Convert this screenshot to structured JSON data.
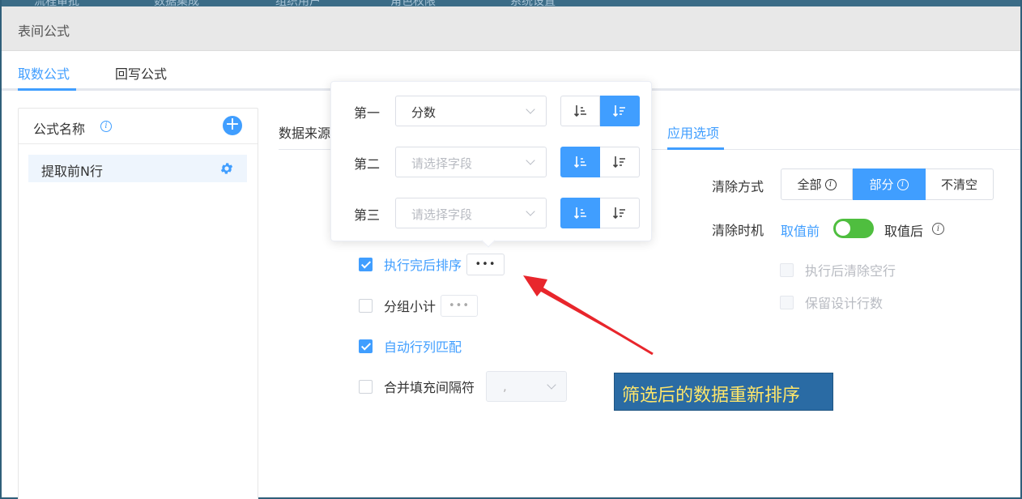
{
  "topnav": {
    "items": [
      "流程审批",
      "数据集成",
      "组织用户",
      "角色权限",
      "系统设置"
    ]
  },
  "dialog": {
    "title": "表间公式"
  },
  "tabs": [
    {
      "label": "取数公式",
      "active": true
    },
    {
      "label": "回写公式",
      "active": false
    }
  ],
  "formula_panel": {
    "header": "公式名称",
    "items": [
      {
        "label": "提取前N行"
      }
    ]
  },
  "inner_tabs": {
    "data_source": "数据来源",
    "apply_options": "应用选项"
  },
  "sort_popover": {
    "rows": [
      {
        "label": "第一",
        "value": "分数",
        "placeholder": "",
        "asc_active": false,
        "desc_active": true
      },
      {
        "label": "第二",
        "value": "",
        "placeholder": "请选择字段",
        "asc_active": true,
        "desc_active": false
      },
      {
        "label": "第三",
        "value": "",
        "placeholder": "请选择字段",
        "asc_active": true,
        "desc_active": false
      }
    ]
  },
  "options": {
    "sort_after": {
      "label": "执行完后排序",
      "checked": true,
      "more": "•••"
    },
    "group_subtotal": {
      "label": "分组小计",
      "checked": false,
      "more": "•••"
    },
    "auto_match": {
      "label": "自动行列匹配",
      "checked": true
    },
    "merge_sep": {
      "label": "合并填充间隔符",
      "checked": false,
      "value": ","
    }
  },
  "clear": {
    "method_label": "清除方式",
    "methods": [
      {
        "label": "全部",
        "active": false
      },
      {
        "label": "部分",
        "active": true
      },
      {
        "label": "不清空",
        "active": false
      }
    ],
    "timing_label": "清除时机",
    "before": "取值前",
    "after": "取值后",
    "toggle_on": true,
    "clear_empty_rows": "执行后清除空行",
    "keep_design_rows": "保留设计行数"
  },
  "annotation": {
    "text": "筛选后的数据重新排序"
  },
  "colors": {
    "primary": "#409eff",
    "switch": "#4fbe3f",
    "callout_bg": "#2a6ba4",
    "callout_text": "#ffe66a",
    "arrow": "#e8262c"
  }
}
